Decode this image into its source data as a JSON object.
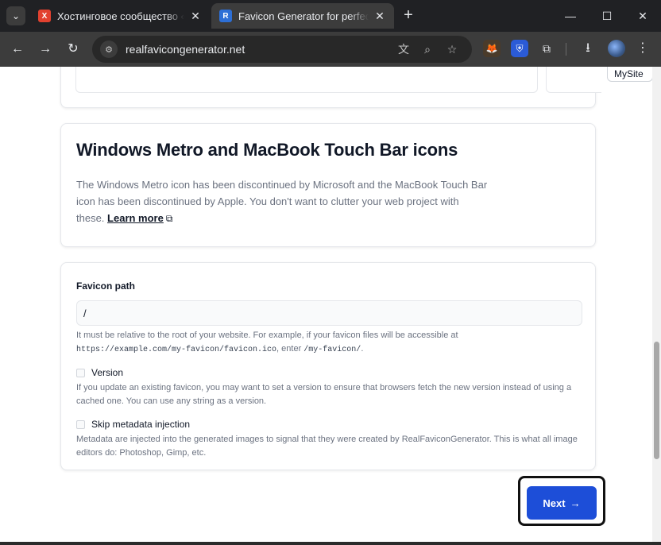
{
  "browser": {
    "tabs": [
      {
        "title": "Хостинговое сообщество «Timeweb»",
        "favicon": "Х",
        "active": false
      },
      {
        "title": "Favicon Generator for perfect icons",
        "favicon": "R",
        "active": true
      }
    ],
    "url": "realfavicongenerator.net",
    "icons": {
      "tab_search": "⌄",
      "close": "✕",
      "new_tab": "+",
      "minimize": "—",
      "maximize": "☐",
      "window_close": "✕",
      "back": "←",
      "forward": "→",
      "reload": "↻",
      "site_info": "⚙",
      "translate": "文",
      "zoom": "⌕",
      "bookmark": "☆",
      "ext_fox": "🦊",
      "ext_shield": "⛨",
      "extensions": "⧉",
      "download": "⭳",
      "menu": "⋮"
    }
  },
  "page": {
    "mysite_chip": "MySite",
    "metro": {
      "title": "Windows Metro and MacBook Touch Bar icons",
      "description": "The Windows Metro icon has been discontinued by Microsoft and the MacBook Touch Bar icon has been discontinued by Apple. You don't want to clutter your web project with these.",
      "learn_more": "Learn more",
      "ext_icon": "⧉"
    },
    "settings": {
      "favicon_path_label": "Favicon path",
      "favicon_path_value": "/",
      "favicon_path_help_1": "It must be relative to the root of your website. For example, if your favicon files will be accessible at",
      "favicon_path_help_code1": "https://example.com/my-favicon/favicon.ico",
      "favicon_path_help_mid": ", enter",
      "favicon_path_help_code2": "/my-favicon/",
      "favicon_path_help_end": ".",
      "version_label": "Version",
      "version_help": "If you update an existing favicon, you may want to set a version to ensure that browsers fetch the new version instead of using a cached one. You can use any string as a version.",
      "skip_label": "Skip metadata injection",
      "skip_help": "Metadata are injected into the generated images to signal that they were created by RealFaviconGenerator. This is what all image editors do: Photoshop, Gimp, etc."
    },
    "next_button": {
      "label": "Next",
      "arrow": "→"
    }
  }
}
